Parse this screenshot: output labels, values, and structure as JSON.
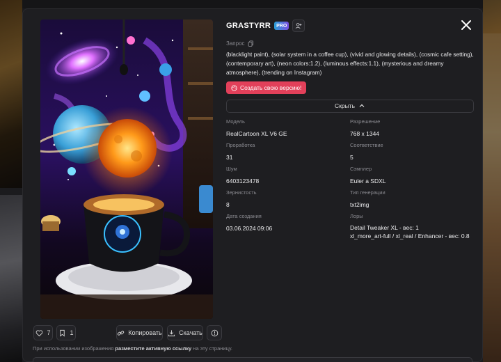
{
  "user": {
    "name": "GRASTYRR",
    "badge": "PRO"
  },
  "prompt": {
    "label": "Запрос",
    "text": "(blacklight paint), (solar system in a coffee cup), (vivid and glowing details), (cosmic cafe setting), (contemporary art), (neon colors:1.2), (luminous effects:1.1), (mysterious and dreamy atmosphere), (trending on Instagram)"
  },
  "remix_button": "Создать свою версию!",
  "hide_button": "Скрыть",
  "params": [
    {
      "label": "Модель",
      "value": "RealCartoon XL V6 GE"
    },
    {
      "label": "Разрешение",
      "value": "768 x 1344"
    },
    {
      "label": "Проработка",
      "value": "31"
    },
    {
      "label": "Соответствие",
      "value": "5"
    },
    {
      "label": "Шум",
      "value": "6403123478"
    },
    {
      "label": "Сэмплер",
      "value": "Euler a SDXL"
    },
    {
      "label": "Зернистость",
      "value": "8"
    },
    {
      "label": "Тип генерации",
      "value": "txt2img"
    },
    {
      "label": "Дата создания",
      "value": "03.06.2024 09:06"
    },
    {
      "label": "Лоры",
      "lines": [
        "Detail Tweaker XL - вес: 1",
        "xl_more_art-full / xl_real / Enhancer - вес: 0.8"
      ]
    }
  ],
  "toolbar": {
    "likes": "7",
    "bookmarks": "1",
    "copy_label": "Копировать",
    "download_label": "Скачать"
  },
  "attribution": {
    "prefix": "При использовании изображения",
    "link": "разместите активную ссылку",
    "suffix": "на эту страницу."
  },
  "colors": {
    "modal_bg": "#1e1e21",
    "accent_remix": "#e2405a",
    "badge_gradient_start": "#2a9fd8",
    "badge_gradient_end": "#7a4fe0"
  },
  "icons": {
    "close": "close-icon",
    "follow": "add-user-icon",
    "copy_prompt": "copy-icon",
    "remix": "palette-icon",
    "hide": "chevron-up-icon",
    "like": "heart-icon",
    "bookmark": "bookmark-icon",
    "copy": "link-icon",
    "download": "download-icon",
    "info": "info-icon"
  }
}
